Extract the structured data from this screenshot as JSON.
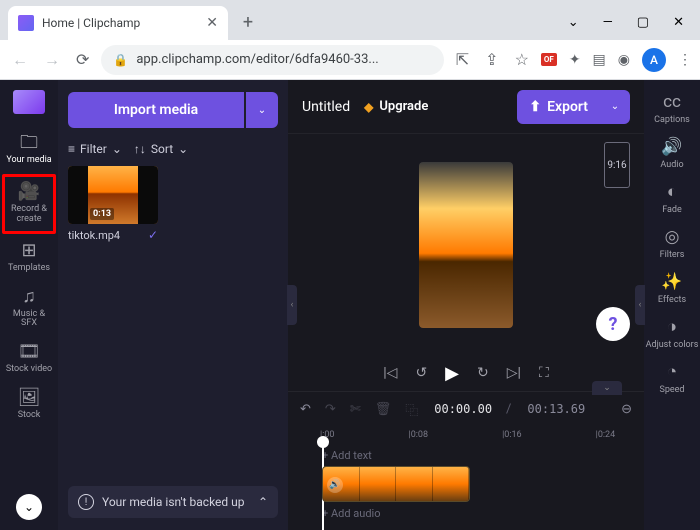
{
  "browser": {
    "tab_title": "Home | Clipchamp",
    "url": "app.clipchamp.com/editor/6dfa9460-33...",
    "avatar_letter": "A"
  },
  "rail": {
    "items": [
      {
        "label": "Your media"
      },
      {
        "label": "Record & create"
      },
      {
        "label": "Templates"
      },
      {
        "label": "Music & SFX"
      },
      {
        "label": "Stock video"
      },
      {
        "label": "Stock"
      }
    ]
  },
  "media_panel": {
    "import_label": "Import media",
    "filter_label": "Filter",
    "sort_label": "Sort",
    "clip": {
      "name": "tiktok.mp4",
      "duration": "0:13"
    },
    "backup_msg": "Your media isn't backed up"
  },
  "topbar": {
    "title": "Untitled",
    "upgrade": "Upgrade",
    "export": "Export",
    "ratio": "9:16"
  },
  "timeline": {
    "time_current": "00:00.00",
    "time_total": "00:13.69",
    "ticks": [
      "|:00",
      "|0:08",
      "|0:16",
      "|0:24"
    ],
    "add_text": "+  Add text",
    "add_audio": "+  Add audio"
  },
  "tools_rail": {
    "items": [
      {
        "label": "Captions"
      },
      {
        "label": "Audio"
      },
      {
        "label": "Fade"
      },
      {
        "label": "Filters"
      },
      {
        "label": "Effects"
      },
      {
        "label": "Adjust colors"
      },
      {
        "label": "Speed"
      }
    ]
  }
}
